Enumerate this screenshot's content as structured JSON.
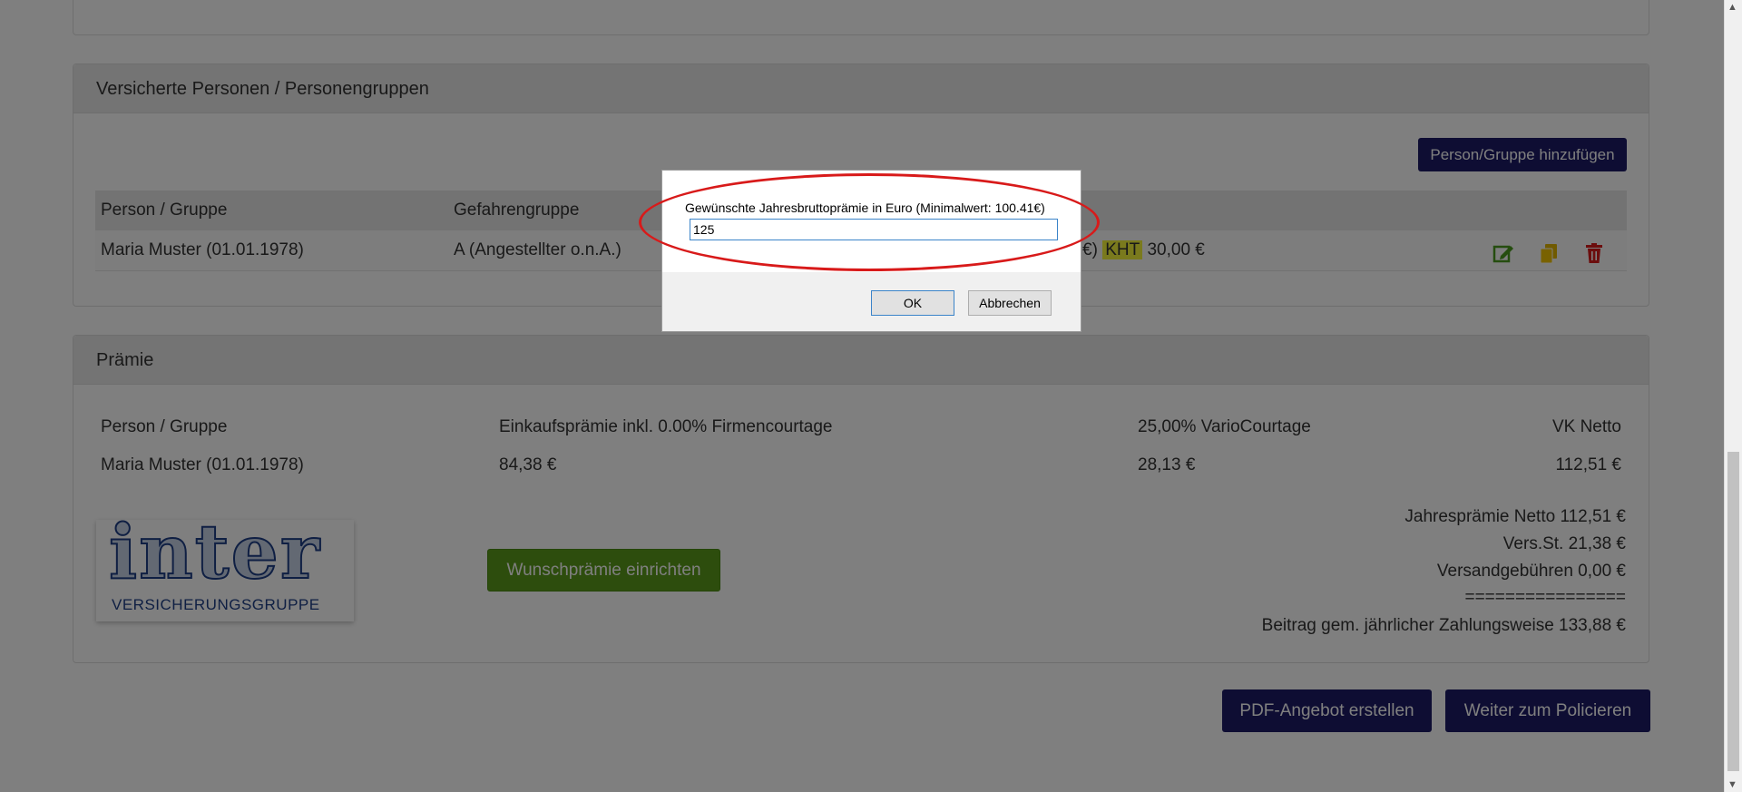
{
  "insured": {
    "heading": "Versicherte Personen / Personengruppen",
    "add_button": "Person/Gruppe hinzufügen",
    "columns": [
      "Person / Gruppe",
      "Gefahrengruppe"
    ],
    "row": {
      "person": "Maria Muster (01.01.1978)",
      "group": "A (Angestellter o.n.A.)",
      "fragment_prefix": "€)",
      "tag": "KHT",
      "amount": "30,00 €"
    }
  },
  "premium": {
    "heading": "Prämie",
    "columns": [
      "Person / Gruppe",
      "Einkaufsprämie inkl. 0.00% Firmencourtage",
      "25,00% VarioCourtage",
      "VK Netto"
    ],
    "row": [
      "Maria Muster (01.01.1978)",
      "84,38 €",
      "28,13 €",
      "112,51 €"
    ],
    "logo": {
      "word": "inter",
      "subtitle": "VERSICHERUNGSGRUPPE"
    },
    "wish_button": "Wunschprämie einrichten",
    "summary": [
      "Jahresprämie Netto 112,51 €",
      "Vers.St. 21,38 €",
      "Versandgebühren 0,00 €",
      "================",
      "Beitrag gem. jährlicher Zahlungsweise 133,88 €"
    ]
  },
  "actions": {
    "pdf_button": "PDF-Angebot erstellen",
    "next_button": "Weiter zum Policieren"
  },
  "dialog": {
    "prompt": "Gewünschte Jahresbruttoprämie in Euro (Minimalwert: 100.41€)",
    "input_value": "125",
    "ok_label": "OK",
    "cancel_label": "Abbrechen"
  },
  "colors": {
    "navy": "#1c1a66",
    "green": "#5a9a1a",
    "highlight": "#f5f53a",
    "annotation_red": "#d81a1a"
  },
  "icons": [
    "edit-icon",
    "copy-icon",
    "trash-icon",
    "scroll-up-icon",
    "scroll-down-icon"
  ]
}
